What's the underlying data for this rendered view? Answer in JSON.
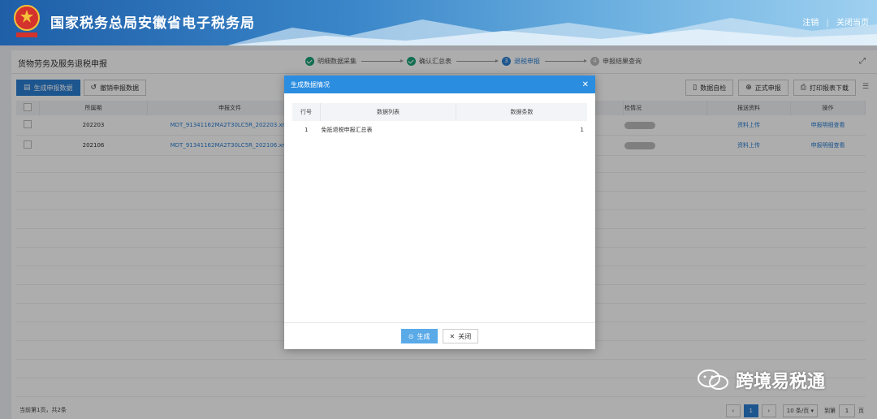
{
  "banner": {
    "title": "国家税务总局安徽省电子税务局",
    "links": [
      "注销",
      "关闭当页"
    ]
  },
  "page": {
    "title": "货物劳务及服务退税申报",
    "steps": [
      {
        "label": "明细数据采集",
        "state": "done"
      },
      {
        "label": "确认汇总表",
        "state": "done"
      },
      {
        "num": "3",
        "label": "退税申报",
        "state": "current"
      },
      {
        "num": "4",
        "label": "申报结果查询",
        "state": "todo"
      }
    ]
  },
  "toolbar": {
    "generate": "生成申报数据",
    "revoke": "撤销申报数据",
    "self_check": "数据自检",
    "formal": "正式申报",
    "print": "打印报表下载"
  },
  "table": {
    "headers": {
      "period": "所属期",
      "file": "申报文件",
      "check": "检情况",
      "material": "报送资料",
      "op": "操作"
    },
    "rows": [
      {
        "period": "202203",
        "file": "MDT_91341162MA2T30LC5R_202203.xml",
        "material": "资料上传",
        "op": "申报明细查看"
      },
      {
        "period": "202106",
        "file": "MDT_91341162MA2T30LC5R_202106.xml",
        "material": "资料上传",
        "op": "申报明细查看"
      }
    ]
  },
  "footer": {
    "summary": "当前第1页，共2条",
    "current_page": "1",
    "page_size": "10 条/页",
    "jump_label": "到第",
    "jump_value": "1",
    "jump_unit": "页"
  },
  "modal": {
    "title": "生成数据情况",
    "headers": {
      "row": "行号",
      "list": "数据列表",
      "count": "数据条数"
    },
    "rows": [
      {
        "row": "1",
        "list": "免抵退税申报汇总表",
        "count": "1"
      }
    ],
    "generate_btn": "生成",
    "close_btn": "关闭"
  },
  "watermark": {
    "text": "跨境易税通"
  },
  "colors": {
    "accent": "#2b7fd3",
    "success": "#1aa37a",
    "modal_header": "#2b8de0"
  }
}
